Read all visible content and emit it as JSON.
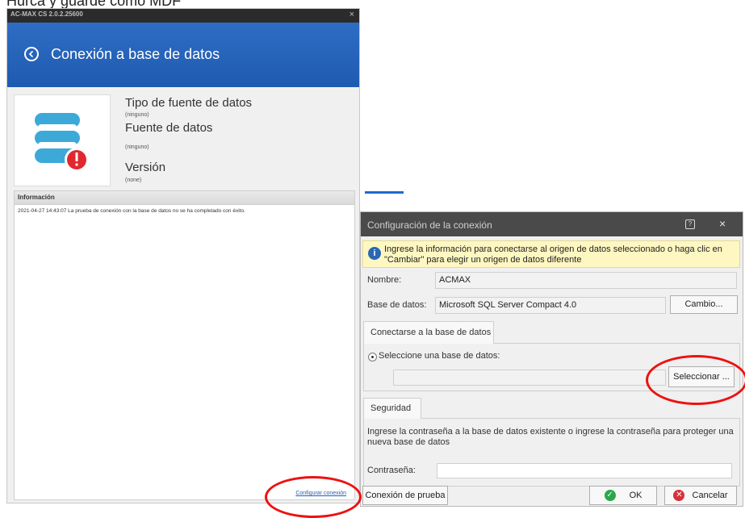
{
  "caption": "Hurca y guarde como MDF",
  "left_window": {
    "titlebar": "AC-MAX CS 2.0.2.25600",
    "close_glyph": "×",
    "header_title": "Conexión a base de datos",
    "db_icon": "database-error-icon",
    "datasource_type_label": "Tipo de fuente de datos",
    "datasource_type_value": "(ninguno)",
    "datasource_label": "Fuente de datos",
    "datasource_value": "(ninguno)",
    "version_label": "Versión",
    "version_value": "(none)",
    "info_header": "Información",
    "info_message": "2021-04-27 14:43:07 La prueba de conexión con la base de datos no se ha completado con éxito.",
    "configure_link": "Configurar conexión"
  },
  "dialog": {
    "title": "Configuración de la conexión",
    "help_glyph": "?",
    "close_glyph": "×",
    "note": "Ingrese la información para conectarse al origen de datos seleccionado o haga clic en \"Cambiar\" para elegir un origen de datos diferente",
    "name_label": "Nombre:",
    "name_value": "ACMAX",
    "db_label": "Base de datos:",
    "db_value": "Microsoft SQL Server Compact 4.0",
    "change_button": "Cambio...",
    "connect_tab": "Conectarse a la base de datos",
    "select_radio_label": "Seleccione una base de datos:",
    "select_button": "Seleccionar ...",
    "security_tab": "Seguridad",
    "security_text": "Ingrese la contraseña a la base de datos existente o ingrese la contraseña para proteger una nueva base de datos",
    "password_label": "Contraseña:",
    "password_value": "",
    "test_button": "Conexión de prueba",
    "ok_button": "OK",
    "cancel_button": "Cancelar"
  },
  "colors": {
    "header_blue": "#1e5bb0",
    "annotation_red": "#e11111",
    "note_yellow": "#fff7c2",
    "db_icon_teal": "#3da9d9"
  }
}
